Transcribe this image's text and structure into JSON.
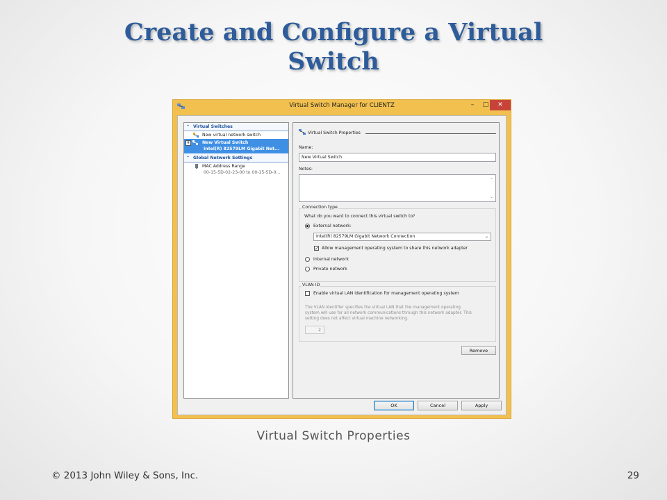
{
  "slide": {
    "title_line1": "Create and Configure a Virtual",
    "title_line2": "Switch",
    "caption": "Virtual Switch Properties",
    "copyright": "© 2013 John Wiley & Sons, Inc.",
    "page_number": "29"
  },
  "window": {
    "title": "Virtual Switch Manager for CLIENTZ",
    "controls": {
      "minimize": "–",
      "maximize": "□",
      "close": "✕"
    },
    "colors": {
      "frame": "#f1c04f",
      "close": "#c7433a",
      "selection": "#3f8fe4",
      "heading": "#1b4e9b"
    }
  },
  "tree": {
    "section_virtual_switches": "Virtual Switches",
    "new_switch_item": "New virtual network switch",
    "selected_switch_name": "New Virtual Switch",
    "selected_switch_adapter": "Intel(R) 82579LM Gigabit Net...",
    "section_global": "Global Network Settings",
    "mac_label": "MAC Address Range",
    "mac_value": "00-15-5D-02-23-00 to 00-15-5D-0..."
  },
  "props": {
    "header": "Virtual Switch Properties",
    "name_label": "Name:",
    "name_value": "New Virtual Switch",
    "notes_label": "Notes:",
    "connection_group": "Connection type",
    "connection_question": "What do you want to connect this virtual switch to?",
    "external_label": "External network:",
    "adapter_selected": "Intel(R) 82579LM Gigabit Network Connection",
    "allow_mgmt_label": "Allow management operating system to share this network adapter",
    "internal_label": "Internal network",
    "private_label": "Private network",
    "vlan_group": "VLAN ID",
    "vlan_enable_label": "Enable virtual LAN identification for management operating system",
    "vlan_desc_1": "The VLAN identifier specifies the virtual LAN that the management operating",
    "vlan_desc_2": "system will use for all network communications through this network adapter. This",
    "vlan_desc_3": "setting does not affect virtual machine networking.",
    "vlan_value": "2",
    "remove_label": "Remove",
    "selected_connection": "External network",
    "allow_mgmt_checked": true,
    "vlan_checked": false
  },
  "footer_buttons": {
    "ok": "OK",
    "cancel": "Cancel",
    "apply": "Apply"
  }
}
